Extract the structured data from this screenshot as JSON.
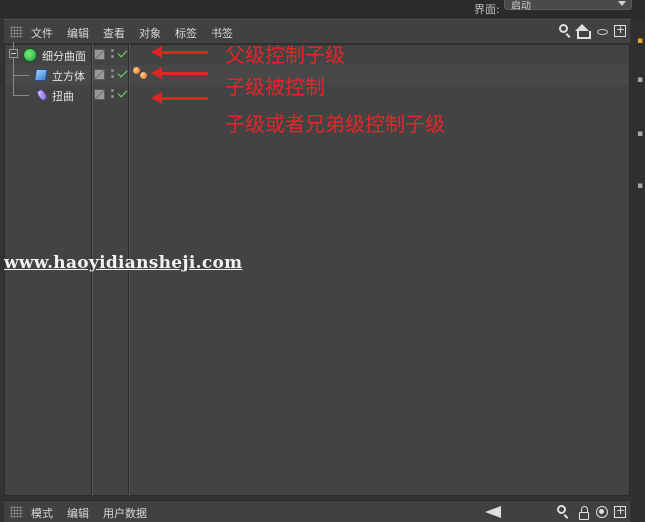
{
  "window": {
    "layout_label": "界面:",
    "layout_value": "启动"
  },
  "menu": {
    "items": [
      "文件",
      "编辑",
      "查看",
      "对象",
      "标签",
      "书签"
    ]
  },
  "objects": [
    {
      "name": "细分曲面",
      "icon": "subdivision-surface-icon"
    },
    {
      "name": "立方体",
      "icon": "cube-icon"
    },
    {
      "name": "扭曲",
      "icon": "twist-deformer-icon"
    }
  ],
  "annotations": [
    "父级控制子级",
    "子级被控制",
    "子级或者兄弟级控制子级"
  ],
  "watermark": "www.haoyidiansheji.com",
  "bottom_menu": {
    "items": [
      "模式",
      "编辑",
      "用户数据"
    ]
  },
  "colors": {
    "annotation_red": "#e12424",
    "background": "#333333",
    "panel": "#434343"
  }
}
